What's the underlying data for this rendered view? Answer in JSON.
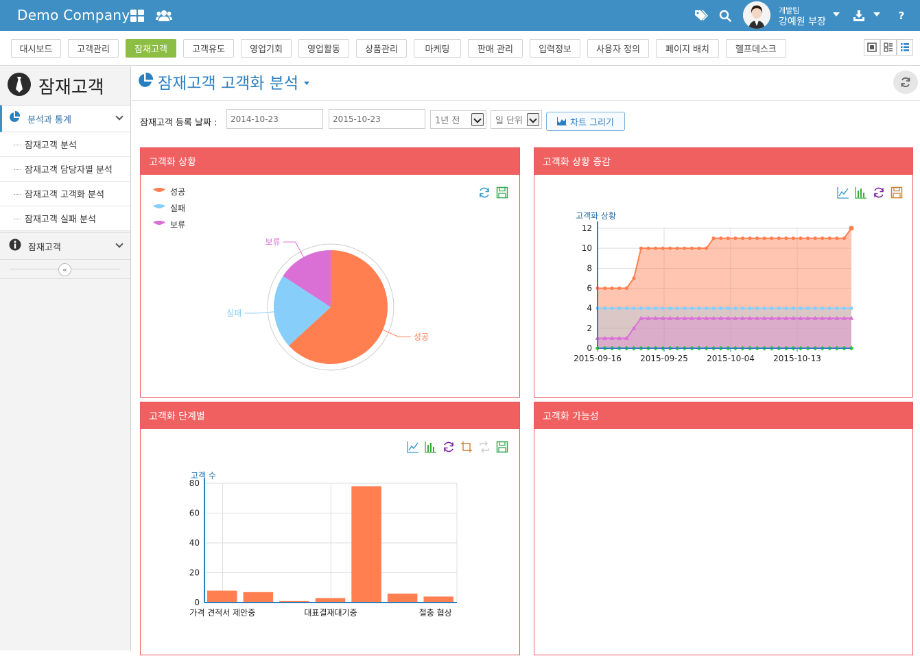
{
  "header": {
    "brand": "Demo Company",
    "user_team": "개발팀",
    "user_name": "강예원 부장"
  },
  "menu": {
    "items": [
      "대시보드",
      "고객관리",
      "잠재고객",
      "고객유도",
      "영업기회",
      "영업활동",
      "상품관리",
      "마케팅",
      "판매 관리",
      "입력정보",
      "사용자 정의",
      "페이지 배치",
      "헬프데스크"
    ],
    "active": "잠재고객"
  },
  "sidebar": {
    "title": "잠재고객",
    "section_open": "분석과 통계",
    "sub_items": [
      "잠재고객 분석",
      "잠재고객 담당자별 분석",
      "잠재고객 고객화 분석",
      "잠재고객 실패 분석"
    ],
    "section_closed": "잠재고객"
  },
  "page": {
    "title": "잠재고객 고객화 분석"
  },
  "filter": {
    "label": "잠재고객 등록 날짜 :",
    "start_date": "2014-10-23",
    "end_date": "2015-10-23",
    "period": "1년 전",
    "unit": "일 단위",
    "draw_button": "차트 그리기"
  },
  "panels": {
    "status": "고객화 상황",
    "trend": "고객화 상황 증감",
    "stage": "고객화 단계별",
    "possibility": "고객화 가능성"
  },
  "colors": {
    "topbar": "#3f8fc4",
    "panel_head": "#f16060",
    "active_menu": "#8cbd45",
    "success": "#ff7f50",
    "fail": "#87cefa",
    "hold": "#da70d6",
    "bottom": "#32cd32"
  },
  "chart_data": [
    {
      "type": "pie",
      "legend": [
        "성공",
        "실패",
        "보류"
      ],
      "labels": [
        "성공",
        "실패",
        "보류"
      ],
      "values": [
        12,
        4,
        3
      ],
      "legend_position": "top-left"
    },
    {
      "type": "area",
      "ylabel": "고객화 상황",
      "ylim": [
        0,
        12
      ],
      "yticks": [
        0,
        2,
        4,
        6,
        8,
        10,
        12
      ],
      "xticks": [
        "2015-09-16",
        "2015-09-25",
        "2015-10-04",
        "2015-10-13"
      ],
      "series": [
        {
          "values": [
            6,
            6,
            6,
            6,
            6,
            7,
            10,
            10,
            10,
            10,
            10,
            10,
            10,
            10,
            10,
            10,
            11,
            11,
            11,
            11,
            11,
            11,
            11,
            11,
            11,
            11,
            11,
            11,
            11,
            11,
            11,
            11,
            11,
            11,
            11,
            12
          ]
        },
        {
          "values": [
            4,
            4,
            4,
            4,
            4,
            4,
            4,
            4,
            4,
            4,
            4,
            4,
            4,
            4,
            4,
            4,
            4,
            4,
            4,
            4,
            4,
            4,
            4,
            4,
            4,
            4,
            4,
            4,
            4,
            4,
            4,
            4,
            4,
            4,
            4,
            4
          ]
        },
        {
          "values": [
            1,
            1,
            1,
            1,
            1,
            2,
            3,
            3,
            3,
            3,
            3,
            3,
            3,
            3,
            3,
            3,
            3,
            3,
            3,
            3,
            3,
            3,
            3,
            3,
            3,
            3,
            3,
            3,
            3,
            3,
            3,
            3,
            3,
            3,
            3,
            3
          ]
        },
        {
          "values": [
            0,
            0,
            0,
            0,
            0,
            0,
            0,
            0,
            0,
            0,
            0,
            0,
            0,
            0,
            0,
            0,
            0,
            0,
            0,
            0,
            0,
            0,
            0,
            0,
            0,
            0,
            0,
            0,
            0,
            0,
            0,
            0,
            0,
            0,
            0,
            0
          ]
        }
      ]
    },
    {
      "type": "bar",
      "ylabel": "고객 수",
      "ylim": [
        0,
        80
      ],
      "yticks": [
        0,
        20,
        40,
        60,
        80
      ],
      "category_labels": [
        "가격 견적서 제안중",
        "대표결재대기중",
        "절충 협상"
      ],
      "values": [
        8,
        7,
        1,
        3,
        78,
        6,
        4
      ]
    }
  ]
}
